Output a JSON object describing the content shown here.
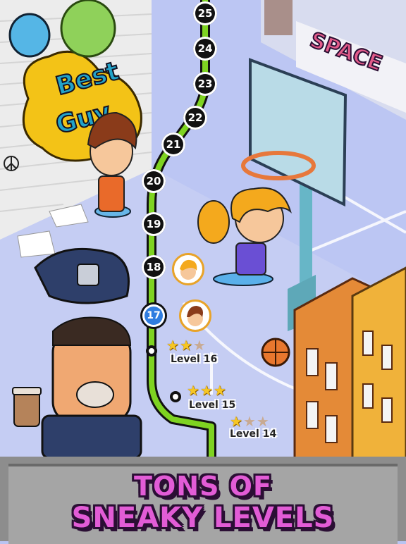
{
  "level_map": {
    "nodes": [
      {
        "number": "25"
      },
      {
        "number": "24"
      },
      {
        "number": "23"
      },
      {
        "number": "22"
      },
      {
        "number": "21"
      },
      {
        "number": "20"
      },
      {
        "number": "19"
      },
      {
        "number": "18"
      }
    ],
    "current_level": {
      "number": "17"
    },
    "completed_levels": [
      {
        "label": "Level 16",
        "stars_earned": 2,
        "stars_total": 3
      },
      {
        "label": "Level 15",
        "stars_earned": 3,
        "stars_total": 3
      },
      {
        "label": "Level 14",
        "stars_earned": 1,
        "stars_total": 3
      }
    ]
  },
  "graffiti": {
    "wall_tag": "Best Guy",
    "garage_tag": "SPACE"
  },
  "banner": {
    "line1": "TONS OF",
    "line2": "SNEAKY LEVELS"
  },
  "colors": {
    "sky": "#b9c4f2",
    "ground": "#c5cdf3",
    "path_green": "#7ed321",
    "title_pink": "#e25cd6",
    "title_outline": "#2b0f34",
    "banner_gray": "#a5a5a5",
    "current_level_blue": "#2f7de0"
  },
  "icons": {
    "star": "star-icon",
    "basketball": "basketball-icon",
    "coffee": "coffee-cup-icon",
    "peace": "peace-symbol-icon"
  }
}
